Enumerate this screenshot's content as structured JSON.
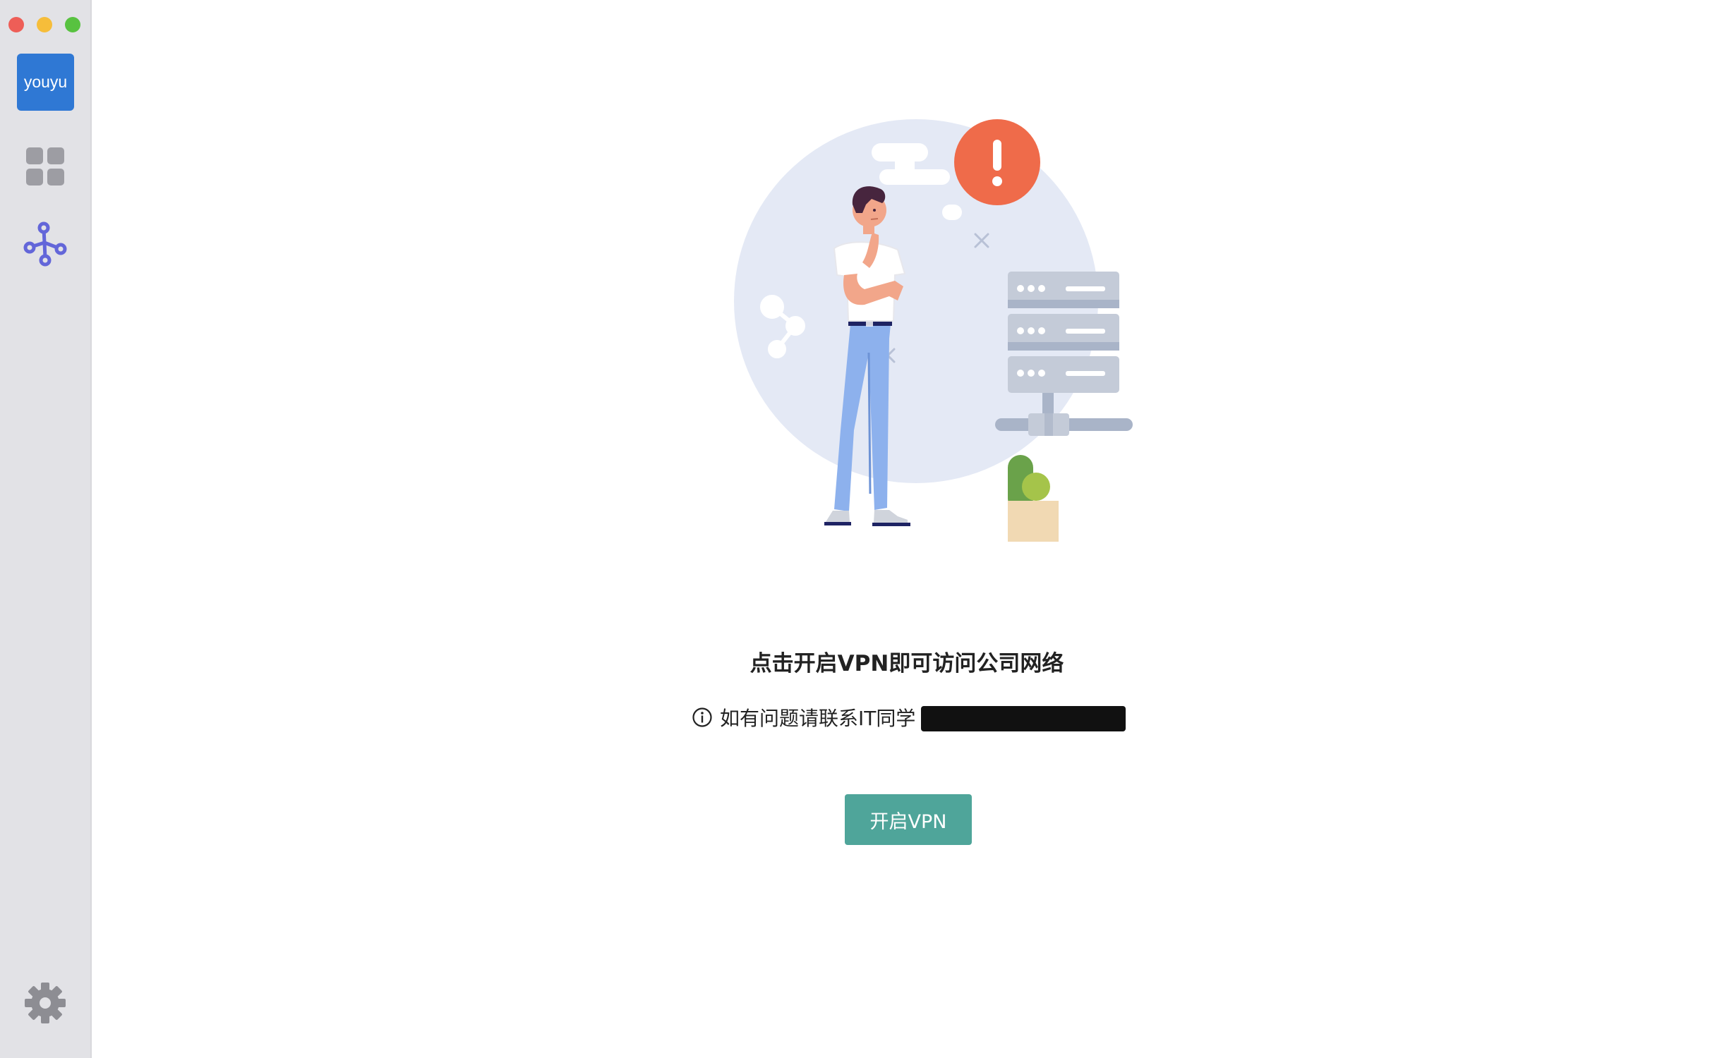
{
  "window": {
    "controls": [
      "close",
      "minimize",
      "zoom"
    ]
  },
  "sidebar": {
    "logo_text": "youyu",
    "items": [
      {
        "name": "apps",
        "icon": "grid-icon"
      },
      {
        "name": "network",
        "icon": "network-nodes-icon"
      }
    ],
    "footer": {
      "icon": "gear-icon"
    }
  },
  "main": {
    "title": "点击开启VPN即可访问公司网络",
    "hint_text": "如有问题请联系IT同学",
    "button_label": "开启VPN"
  },
  "colors": {
    "accent": "#4fa59a",
    "logo_bg": "#2f78d4",
    "network_icon": "#6366d9",
    "alert": "#ef6b4a",
    "sidebar_bg": "#e2e2e6"
  }
}
